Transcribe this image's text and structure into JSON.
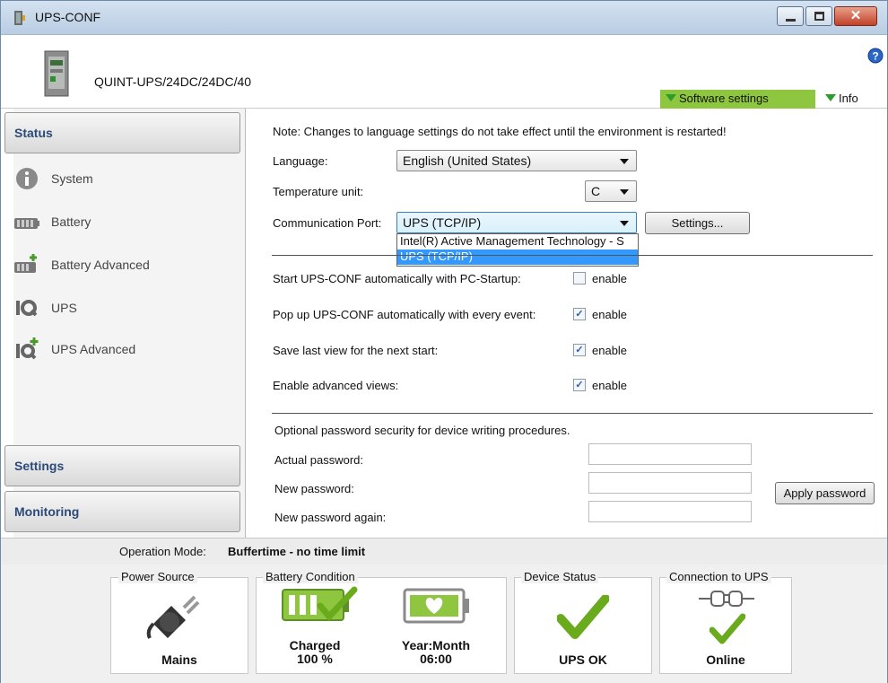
{
  "window": {
    "title": "UPS-CONF"
  },
  "device": {
    "name": "QUINT-UPS/24DC/24DC/40"
  },
  "header": {
    "software_settings": "Software settings",
    "info": "Info"
  },
  "sidebar": {
    "status": "Status",
    "items": [
      {
        "label": "System",
        "icon": "info-icon"
      },
      {
        "label": "Battery",
        "icon": "battery-icon"
      },
      {
        "label": "Battery Advanced",
        "icon": "battery-advanced-icon"
      },
      {
        "label": "UPS",
        "icon": "ups-icon"
      },
      {
        "label": "UPS Advanced",
        "icon": "ups-advanced-icon"
      }
    ],
    "settings": "Settings",
    "monitoring": "Monitoring"
  },
  "content": {
    "note": "Note: Changes to language settings do not take effect until the environment is restarted!",
    "language_label": "Language:",
    "language_value": "English (United States)",
    "temp_label": "Temperature unit:",
    "temp_value": "C",
    "port_label": "Communication Port:",
    "port_value": "UPS (TCP/IP)",
    "settings_button": "Settings...",
    "port_options": [
      "Intel(R) Active Management Technology - S",
      "UPS (TCP/IP)"
    ],
    "options": [
      {
        "label": "Start UPS-CONF automatically with PC-Startup:",
        "checked": false,
        "text": "enable"
      },
      {
        "label": "Pop up UPS-CONF automatically with every event:",
        "checked": true,
        "text": "enable"
      },
      {
        "label": "Save last view for the next start:",
        "checked": true,
        "text": "enable"
      },
      {
        "label": "Enable advanced views:",
        "checked": true,
        "text": "enable"
      }
    ],
    "password_note": "Optional password security for device writing procedures.",
    "actual_password": "Actual password:",
    "new_password": "New password:",
    "new_password_again": "New password again:",
    "apply_password": "Apply password"
  },
  "status": {
    "operation_mode_label": "Operation Mode:",
    "operation_mode_value": "Buffertime - no time limit",
    "power_source_title": "Power Source",
    "power_source_value": "Mains",
    "battery_title": "Battery Condition",
    "battery_state": "Charged",
    "battery_percent": "100 %",
    "battery_age_label": "Year:Month",
    "battery_age_value": "06:00",
    "device_status_title": "Device Status",
    "device_status_value": "UPS OK",
    "connection_title": "Connection to UPS",
    "connection_value": "Online"
  },
  "colors": {
    "accent_green": "#8ec63f",
    "check_green": "#6aab1e",
    "selection_blue": "#3399ff"
  }
}
